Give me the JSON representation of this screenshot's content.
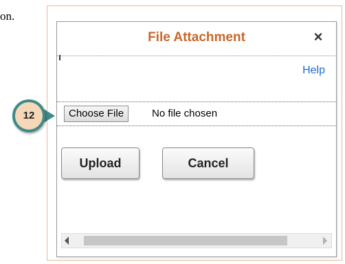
{
  "doc_fragment": "on.",
  "dialog": {
    "title": "File Attachment",
    "close_label": "×",
    "help_label": "Help",
    "file_input": {
      "button_label": "Choose File",
      "status_text": "No file chosen"
    },
    "upload_label": "Upload",
    "cancel_label": "Cancel"
  },
  "callout": {
    "step_number": "12"
  },
  "colors": {
    "title": "#c8662a",
    "link": "#1a6bd1",
    "badge_fill": "#f6d7b7",
    "badge_ring": "#3f8a8a"
  },
  "icons": {
    "close": "close-icon",
    "scroll_left": "scroll-left-arrow-icon",
    "scroll_right": "scroll-right-arrow-icon"
  }
}
